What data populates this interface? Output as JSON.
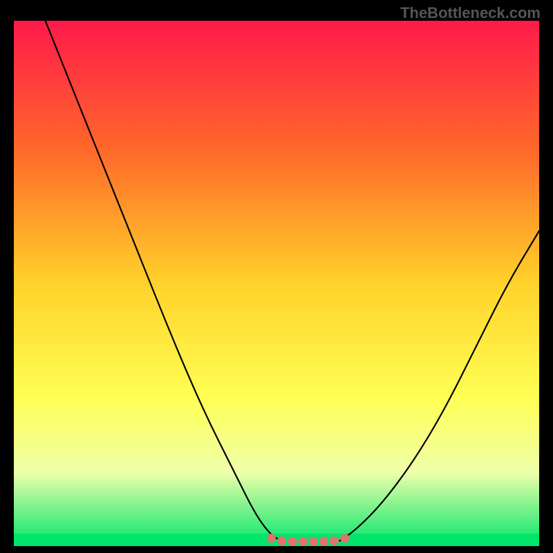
{
  "watermark": "TheBottleneck.com",
  "chart_data": {
    "type": "line",
    "title": "",
    "xlabel": "",
    "ylabel": "",
    "xlim": [
      0,
      100
    ],
    "ylim": [
      0,
      100
    ],
    "background_gradient": {
      "stops": [
        {
          "offset": 0,
          "color": "#ff1a4a"
        },
        {
          "offset": 25,
          "color": "#ff6a2a"
        },
        {
          "offset": 50,
          "color": "#ffd22a"
        },
        {
          "offset": 72,
          "color": "#ffff55"
        },
        {
          "offset": 86,
          "color": "#eeffaa"
        },
        {
          "offset": 100,
          "color": "#00e56b"
        }
      ]
    },
    "series": [
      {
        "name": "left-curve",
        "color": "#000000",
        "x": [
          6,
          12,
          18,
          24,
          30,
          36,
          42,
          46,
          49,
          51
        ],
        "y": [
          100,
          85,
          70,
          55,
          40,
          26,
          14,
          6,
          2,
          1
        ]
      },
      {
        "name": "right-curve",
        "color": "#000000",
        "x": [
          62,
          65,
          70,
          76,
          82,
          88,
          94,
          100
        ],
        "y": [
          1,
          3,
          8,
          16,
          26,
          38,
          50,
          60
        ]
      },
      {
        "name": "bottom-dots",
        "color": "#e0736f",
        "x": [
          49,
          51,
          53,
          55,
          57,
          59,
          61,
          63
        ],
        "y": [
          1.5,
          1,
          0.9,
          0.9,
          0.9,
          0.9,
          1,
          1.5
        ]
      }
    ],
    "annotations": []
  }
}
